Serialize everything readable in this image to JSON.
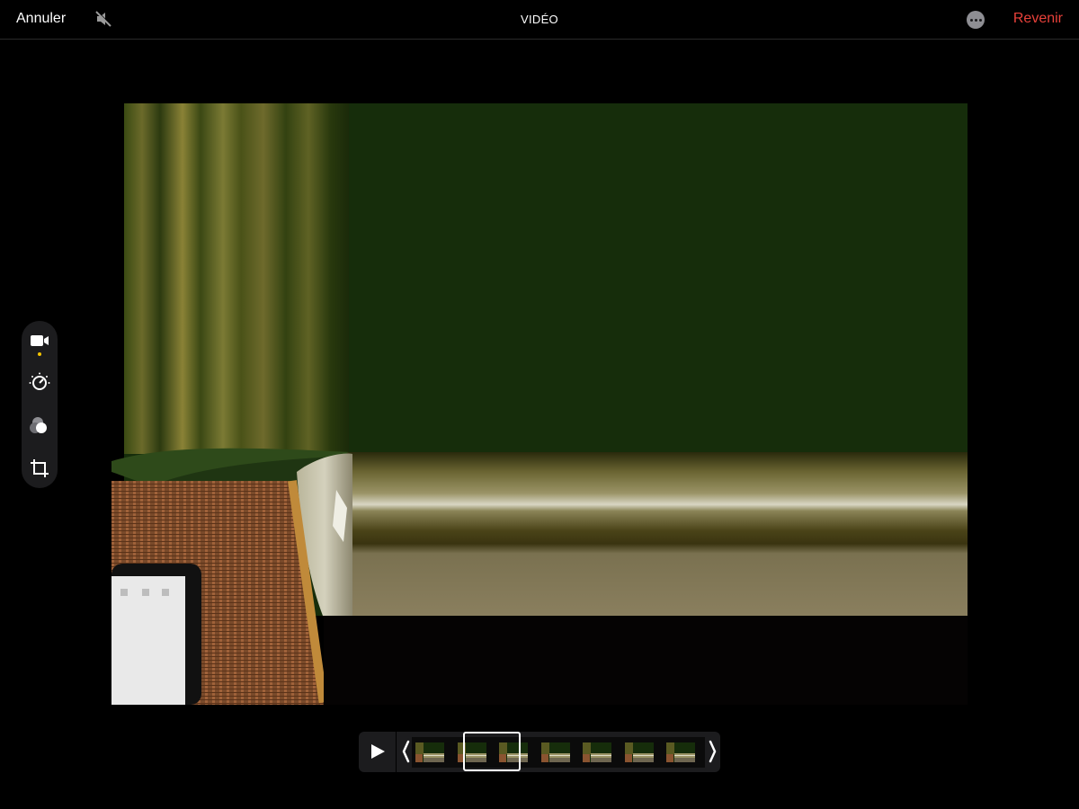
{
  "header": {
    "cancel_label": "Annuler",
    "title": "VIDÉO",
    "revert_label": "Revenir"
  },
  "icons": {
    "mute": "speaker-muted-icon",
    "more": "ellipsis-circle-icon",
    "video_tool": "video-camera-icon",
    "adjust_tool": "adjust-dial-icon",
    "filters_tool": "filters-circles-icon",
    "crop_tool": "crop-rotate-icon",
    "play": "play-icon",
    "trim_start": "trim-start-bracket-icon",
    "trim_end": "trim-end-bracket-icon"
  },
  "colors": {
    "accent_destructive": "#e8413a",
    "selected_tool_dot": "#f5c400",
    "background": "#000000",
    "panel": "#1c1c1e"
  },
  "timeline": {
    "thumbnail_count": 7
  }
}
